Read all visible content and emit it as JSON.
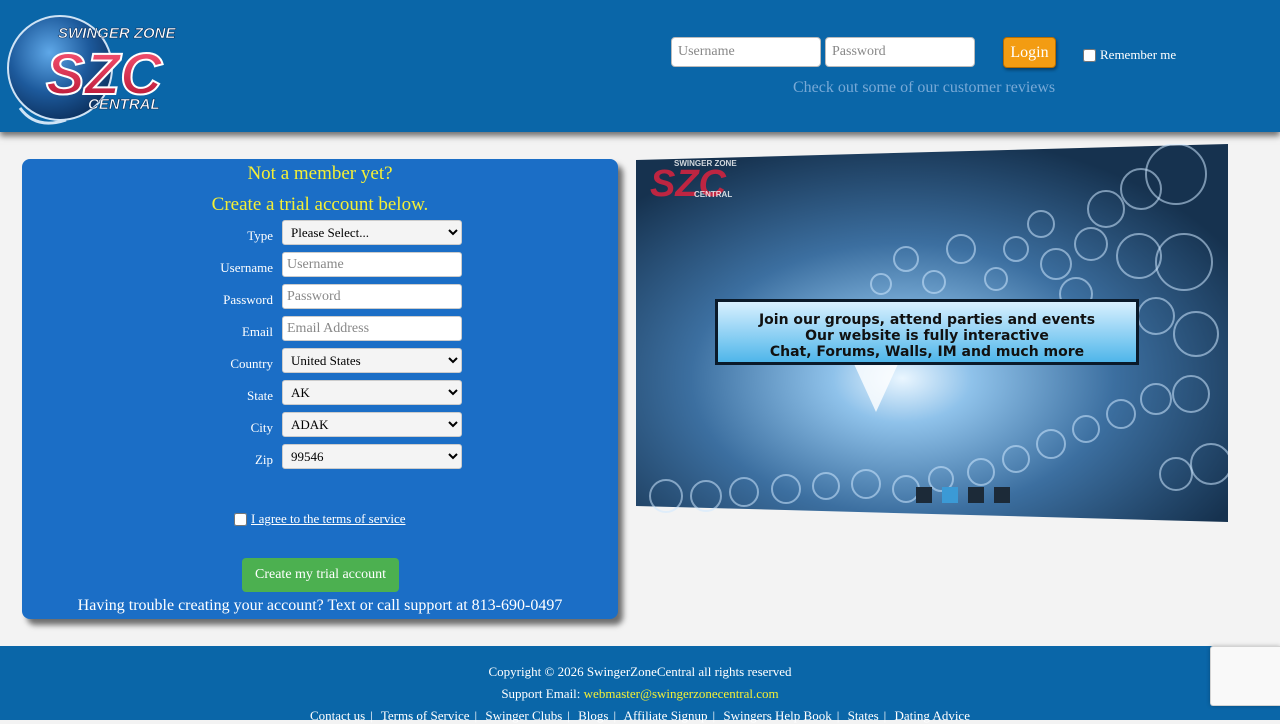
{
  "header": {
    "logo": {
      "line1": "SWINGER ZONE",
      "monogram": "SZC",
      "line2": "CENTRAL"
    },
    "login": {
      "username_placeholder": "Username",
      "password_placeholder": "Password",
      "login_label": "Login",
      "remember_label": "Remember me"
    },
    "reviews_link": "Check out some of our customer reviews"
  },
  "signup": {
    "heading": "Not a member yet?",
    "subheading": "Create a trial account below.",
    "fields": {
      "type": {
        "label": "Type",
        "value": "Please Select..."
      },
      "username": {
        "label": "Username",
        "placeholder": "Username"
      },
      "password": {
        "label": "Password",
        "placeholder": "Password"
      },
      "email": {
        "label": "Email",
        "placeholder": "Email Address"
      },
      "country": {
        "label": "Country",
        "value": "United States"
      },
      "state": {
        "label": "State",
        "value": "AK"
      },
      "city": {
        "label": "City",
        "value": "ADAK"
      },
      "zip": {
        "label": "Zip",
        "value": "99546"
      }
    },
    "terms_label": "I agree to the terms of service",
    "create_button": "Create my trial account",
    "support_note": "Having trouble creating your account? Text or call support at 813-690-0497"
  },
  "slider": {
    "slide_logo": {
      "line1": "SWINGER ZONE",
      "monogram": "SZC",
      "line2": "CENTRAL"
    },
    "banner_lines": [
      "Join our groups, attend parties and events",
      "Our website is fully interactive",
      "Chat, Forums, Walls, IM and much more"
    ],
    "active_dot": 2,
    "dot_count": 4
  },
  "footer": {
    "copyright": "Copyright © 2026 SwingerZoneCentral all rights reserved",
    "support_label": "Support Email:",
    "support_email": "webmaster@swingerzonecentral.com",
    "links": [
      "Contact us",
      "Terms of Service",
      "Swinger Clubs",
      "Blogs",
      "Affiliate Signup",
      "Swingers Help Book",
      "States",
      "Dating Advice"
    ]
  },
  "colors": {
    "header_bg": "#0a66a8",
    "panel_bg": "#1b6ec6",
    "heading_yellow": "#f5ef35",
    "login_orange": "#f39c12",
    "create_green": "#4cb050"
  }
}
